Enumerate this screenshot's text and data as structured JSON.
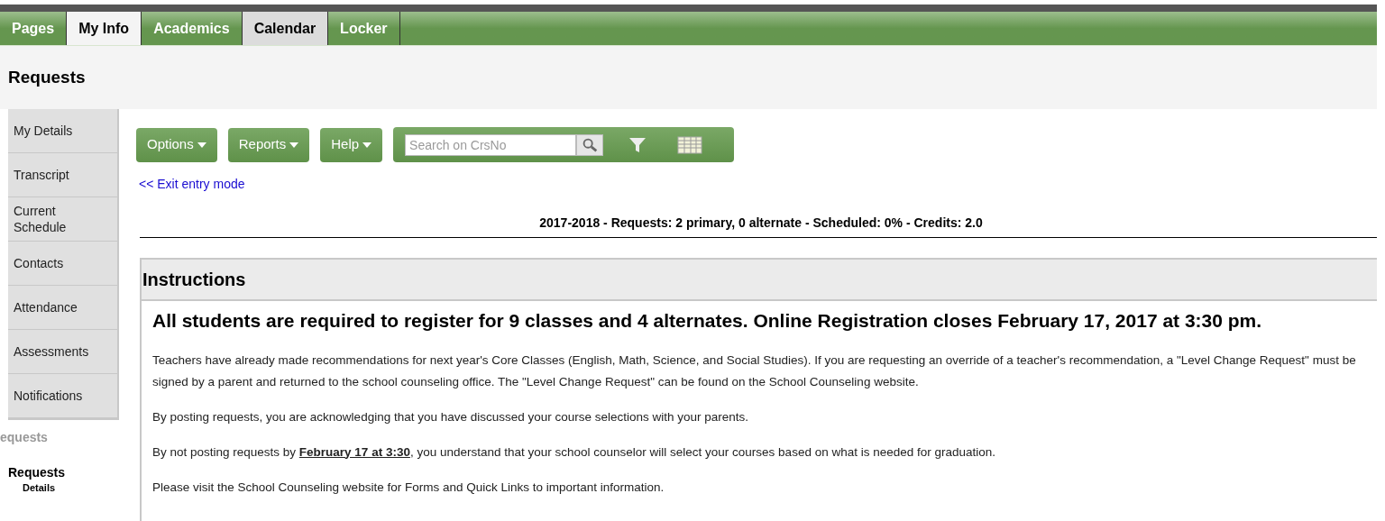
{
  "tabs": [
    {
      "label": "Pages",
      "selected": false,
      "highlighted": false
    },
    {
      "label": "My Info",
      "selected": true,
      "highlighted": false
    },
    {
      "label": "Academics",
      "selected": false,
      "highlighted": false
    },
    {
      "label": "Calendar",
      "selected": false,
      "highlighted": true
    },
    {
      "label": "Locker",
      "selected": false,
      "highlighted": false
    }
  ],
  "page_title": "Requests",
  "sidebar": {
    "items": [
      {
        "label": "My Details"
      },
      {
        "label": "Transcript"
      },
      {
        "label": "Current Schedule"
      },
      {
        "label": "Contacts"
      },
      {
        "label": "Attendance"
      },
      {
        "label": "Assessments"
      },
      {
        "label": "Notifications"
      }
    ],
    "section_label": "equests",
    "current": "Requests",
    "sub_item": "Details"
  },
  "toolbar": {
    "menus": [
      "Options",
      "Reports",
      "Help"
    ],
    "search": {
      "placeholder": "Search on CrsNo"
    }
  },
  "exit_link": "<< Exit entry mode",
  "summary": "2017-2018 - Requests: 2 primary, 0 alternate - Scheduled: 0% - Credits: 2.0",
  "instructions": {
    "title": "Instructions",
    "headline": "All students are required to register for 9 classes and 4 alternates. Online Registration closes February 17, 2017 at 3:30 pm.",
    "paragraphs": [
      "Teachers have already made recommendations for next year's Core Classes (English, Math, Science, and Social Studies).  If you are requesting an override of a teacher's recommendation, a \"Level Change Request\" must be signed by a parent and returned to the school counseling office. The \"Level Change Request\" can be found on the School Counseling website.",
      "By posting requests, you are acknowledging that you have discussed your course selections with your parents.",
      "By not posting requests by **February 17 at 3:30**, you understand that your school counselor will select your courses based on what is needed for graduation.",
      "Please visit the School Counseling website for Forms and Quick Links to important information."
    ]
  }
}
